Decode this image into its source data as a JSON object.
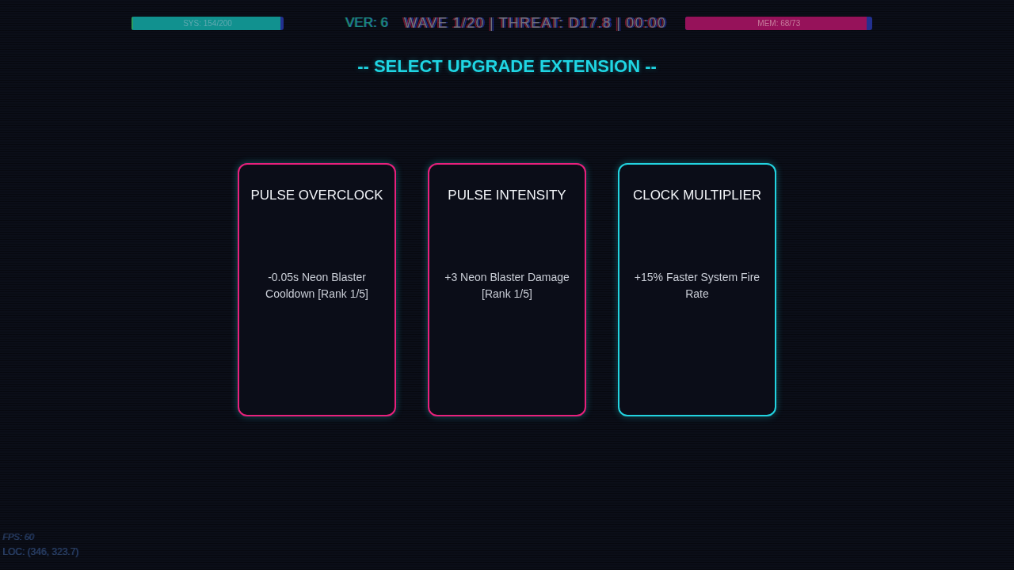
{
  "hud": {
    "sys_meter": {
      "label": "SYS: 154/200",
      "level": 0.98
    },
    "version": "VER: 6",
    "status": "WAVE 1/20 | THREAT: D17.8 | 00:00",
    "mem_meter": {
      "label": "MEM: 68/73",
      "level": 0.97
    }
  },
  "title": "-- SELECT UPGRADE EXTENSION --",
  "cards": [
    {
      "name": "PULSE OVERCLOCK",
      "description": "-0.05s Neon Blaster Cooldown [Rank 1/5]",
      "color": "#e8207c"
    },
    {
      "name": "PULSE INTENSITY",
      "description": "+3 Neon Blaster Damage [Rank 1/5]",
      "color": "#e8207c"
    },
    {
      "name": "CLOCK MULTIPLIER",
      "description": "+15% Faster System Fire Rate",
      "color": "#22d3e0"
    }
  ],
  "debug": {
    "fps": "FPS: 60",
    "location": "LOC: (346, 323.7)"
  }
}
